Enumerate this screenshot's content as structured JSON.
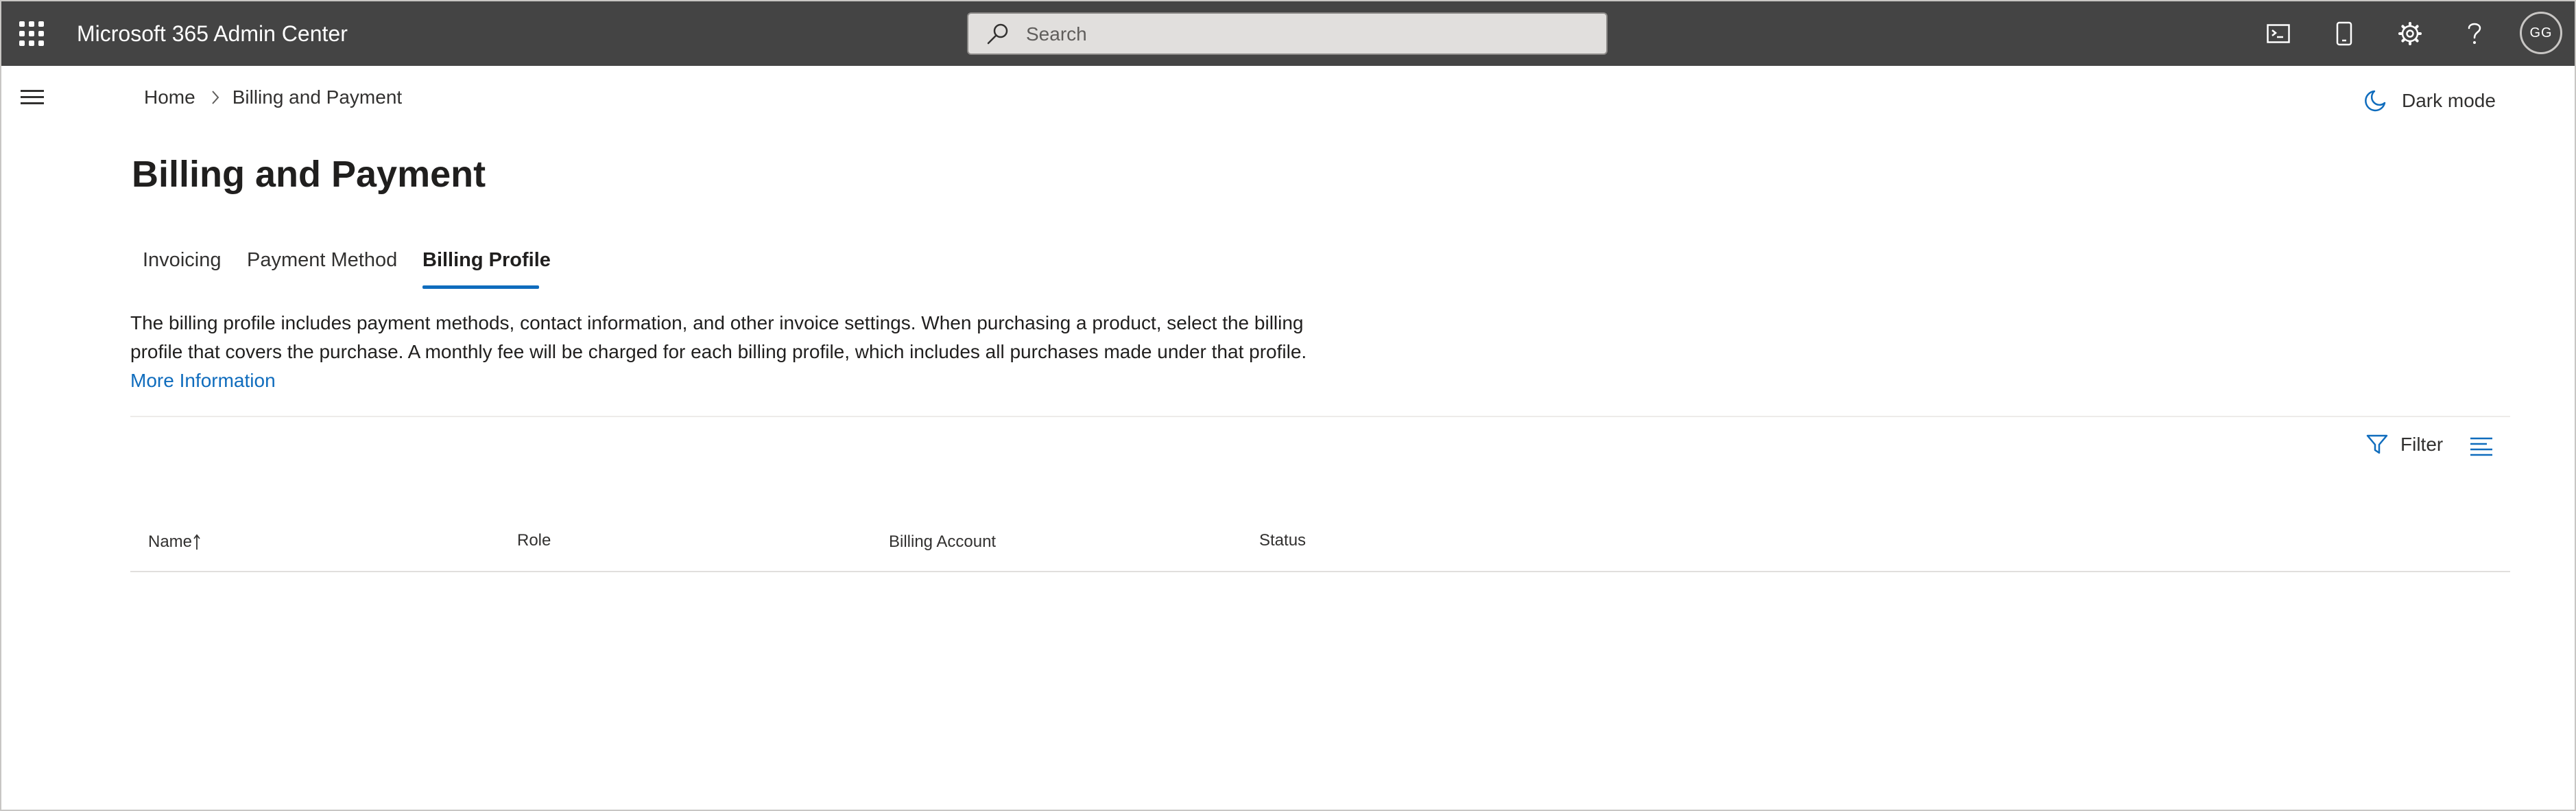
{
  "app": {
    "title": "Microsoft 365 Admin Center",
    "search_placeholder": "Search",
    "user_initials": "GG",
    "topbar_icons": [
      "terminal-icon",
      "mobile-icon",
      "gear-icon",
      "help-icon"
    ]
  },
  "colors": {
    "topbar_bg": "#444444",
    "accent": "#0f6cbd",
    "search_bg": "#e1dfdd"
  },
  "breadcrumb": {
    "home": "Home",
    "current": "Billing and Payment"
  },
  "dark_mode_label": "Dark mode",
  "page": {
    "title": "Billing and Payment"
  },
  "tabs": [
    {
      "label": "Invoicing",
      "active": false
    },
    {
      "label": "Payment Method",
      "active": false
    },
    {
      "label": "Billing Profile",
      "active": true
    }
  ],
  "content": {
    "description_line1": "The billing profile includes payment methods, contact information, and other invoice settings. When purchasing a product, select the billing",
    "description_line2": "profile that covers the purchase. A monthly fee will be charged for each billing profile, which includes all purchases made under that profile.",
    "more_link": "More Information"
  },
  "toolbar": {
    "filter_label": "Filter"
  },
  "table": {
    "columns": [
      {
        "label": "Name",
        "sorted": "ascending"
      },
      {
        "label": "Role"
      },
      {
        "label": "Billing Account"
      },
      {
        "label": "Status"
      }
    ],
    "rows": []
  }
}
